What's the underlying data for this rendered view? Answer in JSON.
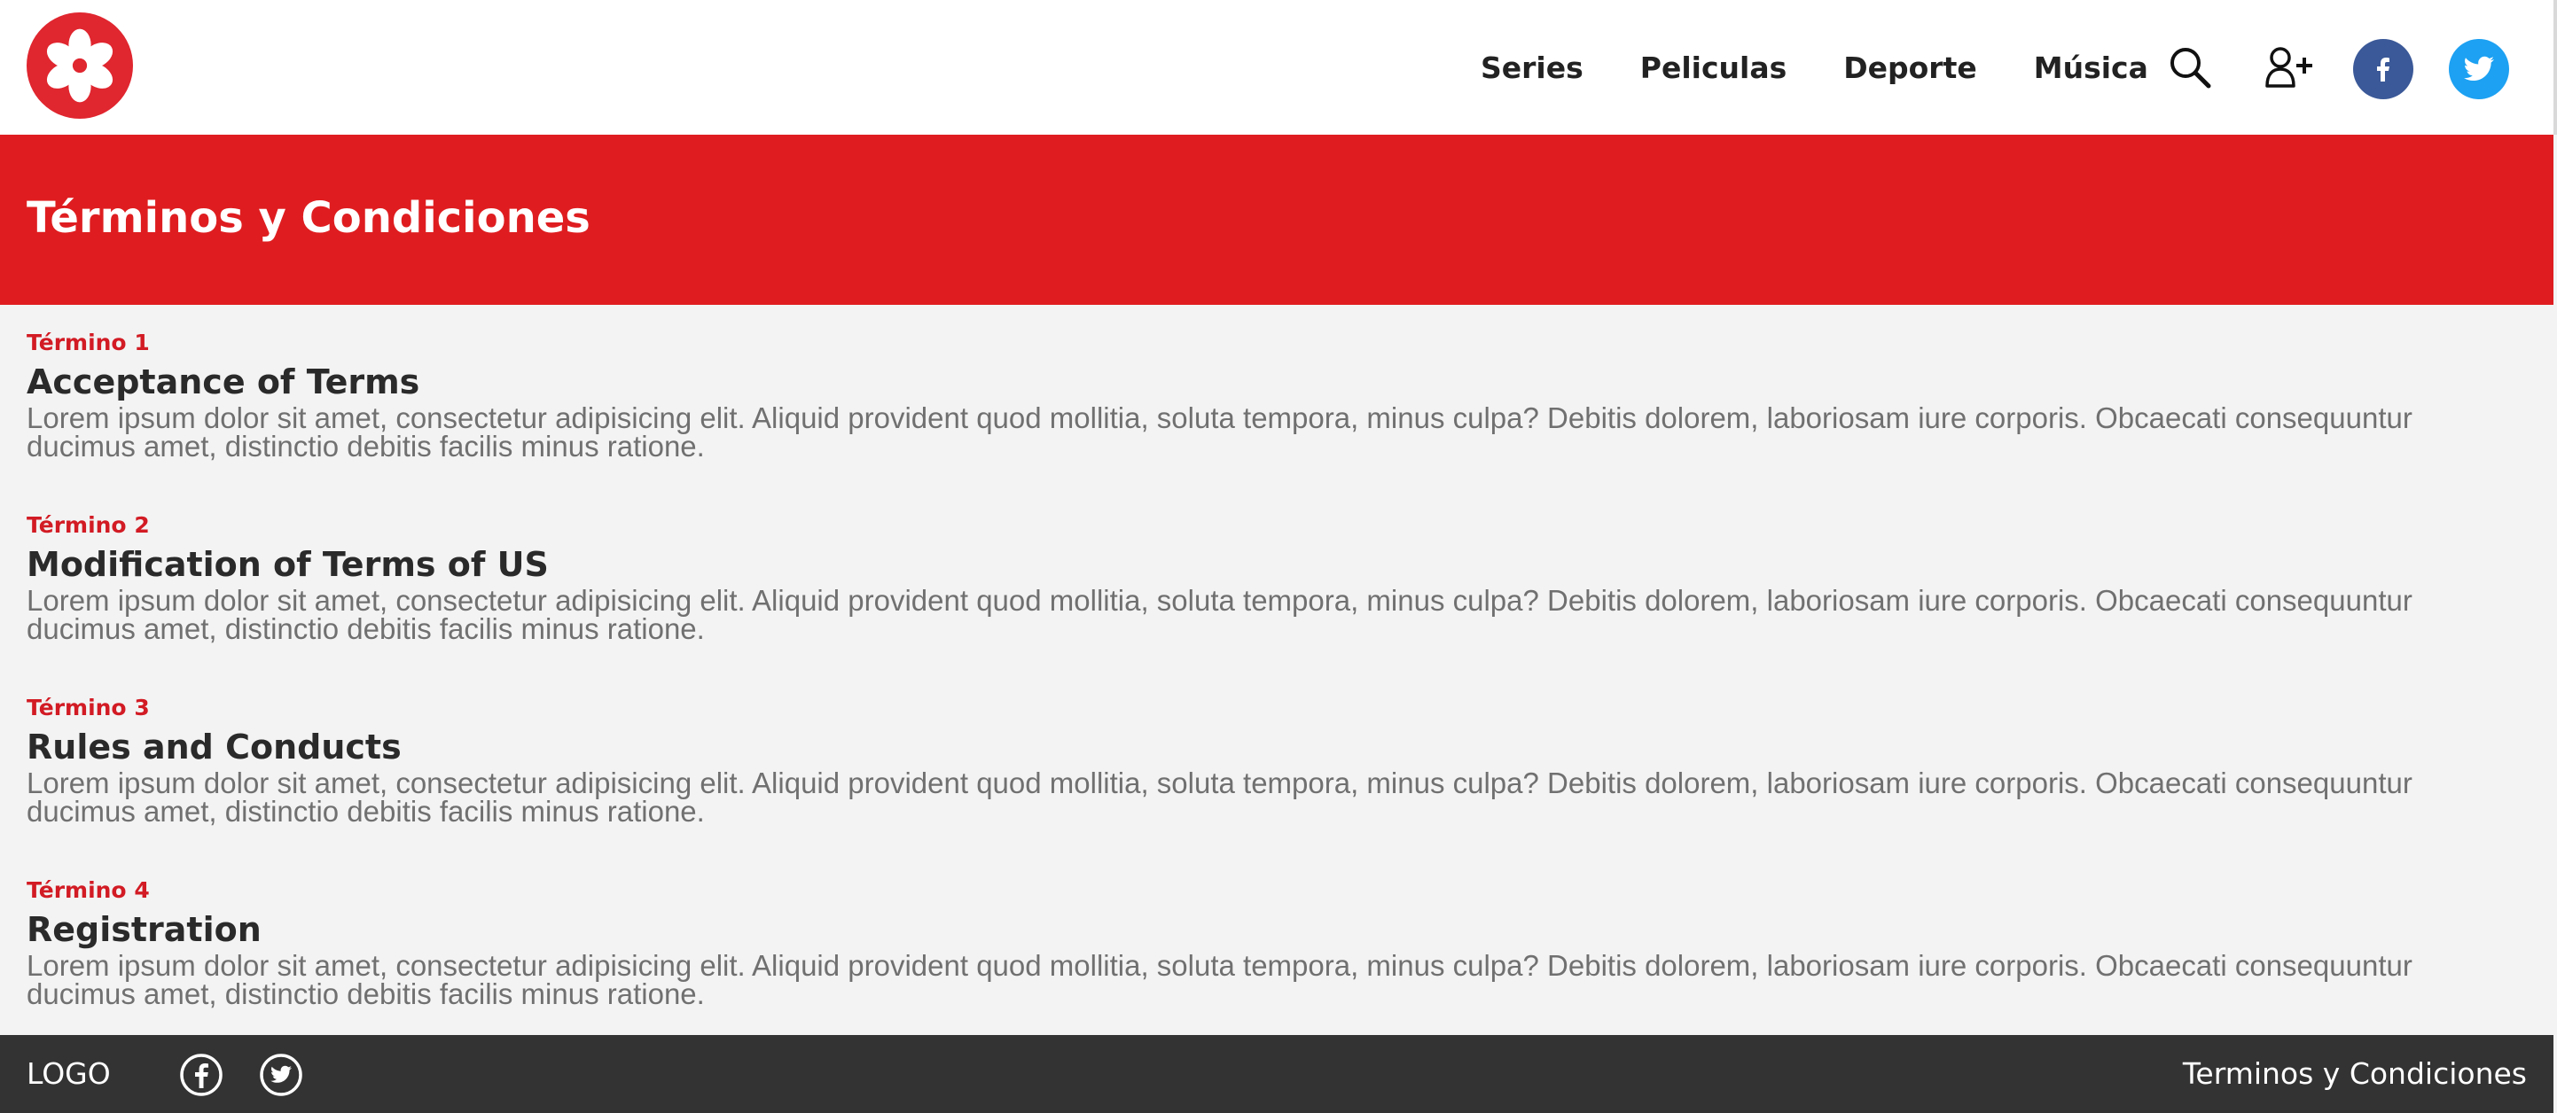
{
  "header": {
    "logo_icon": "flower-icon",
    "brand_color": "#e0262f",
    "nav": [
      {
        "label": "Series"
      },
      {
        "label": "Peliculas"
      },
      {
        "label": "Deporte"
      },
      {
        "label": "Música"
      }
    ],
    "actions": {
      "search_icon": "search-icon",
      "add_user_icon": "add-user-icon",
      "facebook_icon": "facebook-icon",
      "twitter_icon": "twitter-icon",
      "facebook_color": "#3b5998",
      "twitter_color": "#1da1f2"
    }
  },
  "banner": {
    "title": "Términos y Condiciones",
    "color": "#df1d20"
  },
  "terms": [
    {
      "label": "Término 1",
      "heading": "Acceptance of Terms",
      "body": "Lorem ipsum dolor sit amet, consectetur adipisicing elit. Aliquid provident quod mollitia, soluta tempora, minus culpa? Debitis dolorem, laboriosam iure corporis. Obcaecati consequuntur ducimus amet, distinctio debitis facilis minus ratione."
    },
    {
      "label": "Término 2",
      "heading": "Modification of Terms of US",
      "body": "Lorem ipsum dolor sit amet, consectetur adipisicing elit. Aliquid provident quod mollitia, soluta tempora, minus culpa? Debitis dolorem, laboriosam iure corporis. Obcaecati consequuntur ducimus amet, distinctio debitis facilis minus ratione."
    },
    {
      "label": "Término 3",
      "heading": "Rules and Conducts",
      "body": "Lorem ipsum dolor sit amet, consectetur adipisicing elit. Aliquid provident quod mollitia, soluta tempora, minus culpa? Debitis dolorem, laboriosam iure corporis. Obcaecati consequuntur ducimus amet, distinctio debitis facilis minus ratione."
    },
    {
      "label": "Término 4",
      "heading": "Registration",
      "body": "Lorem ipsum dolor sit amet, consectetur adipisicing elit. Aliquid provident quod mollitia, soluta tempora, minus culpa? Debitis dolorem, laboriosam iure corporis. Obcaecati consequuntur ducimus amet, distinctio debitis facilis minus ratione."
    }
  ],
  "footer": {
    "logo_text": "LOGO",
    "facebook_icon": "facebook-outline-icon",
    "twitter_icon": "twitter-outline-icon",
    "link": "Terminos y Condiciones",
    "background": "#333333"
  }
}
